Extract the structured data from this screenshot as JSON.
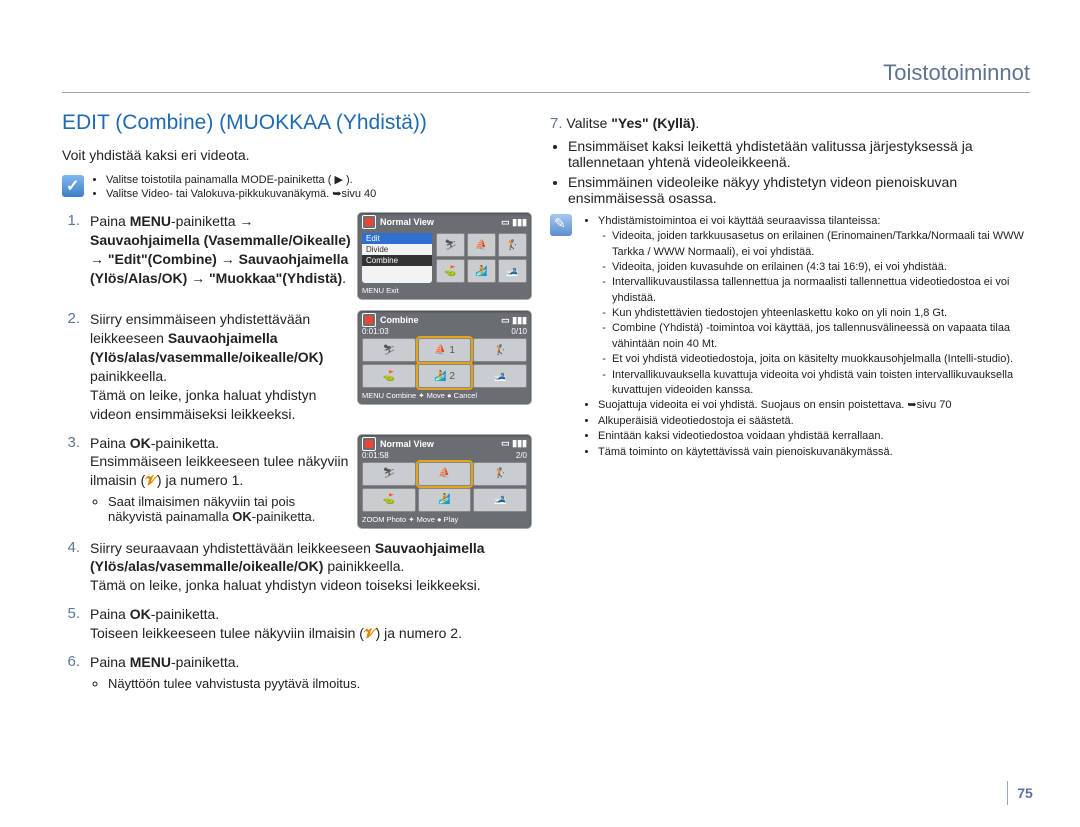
{
  "section": "Toistotoiminnot",
  "heading": "EDIT (Combine) (MUOKKAA (Yhdistä))",
  "intro": "Voit yhdistää kaksi eri videota.",
  "precheck": [
    "Valitse toistotila painamalla MODE-painiketta ( ▶ ).",
    "Valitse Video- tai Valokuva-pikkukuvanäkymä. ➥sivu 40"
  ],
  "screens": {
    "nv_title": "Normal View",
    "combine_title": "Combine",
    "menu_edit": "Edit",
    "menu_divide": "Divide",
    "menu_combine": "Combine",
    "time": "0:01:03",
    "time2": "0:01:58",
    "counter1": "0/10",
    "counter2": "2/0",
    "footer_menu": "MENU Exit",
    "footer_combine": "MENU Combine  ✦ Move  ● Cancel",
    "footer_nv": "ZOOM Photo  ✦ Move  ● Play"
  },
  "steps": [
    {
      "html": "Paina <b>MENU</b>-painiketta → <b>Sauvaohjaimella (Vasemmalle/Oikealle)</b> → <b>\"Edit\"(Combine)</b> → <b>Sauvaohjaimella (Ylös/Alas/OK)</b> → <b>\"Muokkaa\"(Yhdistä)</b>.",
      "screen": "nv1"
    },
    {
      "html": "Siirry ensimmäiseen yhdistettävään leikkeeseen <b>Sauvaohjaimella (Ylös/alas/vasemmalle/oikealle/OK)</b> painikkeella.<br>Tämä on leike, jonka haluat yhdistyn videon ensimmäiseksi leikkeeksi.",
      "screen": "combine"
    },
    {
      "html": "Paina <b>OK</b>-painiketta.<br>Ensimmäiseen leikkeeseen tulee näkyviin ilmaisin (<span class='vmark'>𝓥</span>) ja numero 1.",
      "bullets": [
        "Saat ilmaisimen näkyviin tai pois näkyvistä painamalla <b>OK</b>-painiketta."
      ],
      "screen": "nv2"
    },
    {
      "html": "Siirry seuraavaan yhdistettävään leikkeeseen <b>Sauvaohjaimella (Ylös/alas/vasemmalle/oikealle/OK)</b> painikkeella.<br>Tämä on leike, jonka haluat yhdistyn videon toiseksi leikkeeksi."
    },
    {
      "html": "Paina <b>OK</b>-painiketta.<br>Toiseen leikkeeseen tulee näkyviin ilmaisin (<span class='vmark'>𝓥</span>) ja numero 2."
    },
    {
      "html": "Paina <b>MENU</b>-painiketta.",
      "bullets": [
        "Näyttöön tulee vahvistusta pyytävä ilmoitus."
      ]
    }
  ],
  "step7_label": "7.",
  "step7": "Valitse <b>\"Yes\" (Kyllä)</b>.",
  "step7_bullets": [
    "Ensimmäiset kaksi leikettä yhdistetään valitussa järjestyksessä ja tallennetaan yhtenä videoleikkeenä.",
    "Ensimmäinen videoleike näkyy yhdistetyn videon pienoiskuvan ensimmäisessä osassa."
  ],
  "note": {
    "lead": "Yhdistämistoimintoa ei voi käyttää seuraavissa tilanteissa:",
    "items": [
      "Videoita, joiden tarkkuusasetus on erilainen (Erinomainen/Tarkka/Normaali tai WWW Tarkka / WWW Normaali), ei voi yhdistää.",
      "Videoita, joiden kuvasuhde on erilainen (4:3 tai 16:9), ei voi yhdistää.",
      "Intervallikuvaustilassa tallennettua ja normaalisti tallennettua videotiedostoa ei voi yhdistää.",
      "Kun yhdistettävien tiedostojen yhteenlaskettu koko on yli noin 1,8 Gt.",
      "Combine (Yhdistä) -toimintoa voi käyttää, jos tallennusvälineessä on vapaata tilaa vähintään noin 40 Mt.",
      "Et voi yhdistä videotiedostoja, joita on käsitelty muokkausohjelmalla (Intelli-studio).",
      "Intervallikuvauksella kuvattuja videoita voi yhdistä vain toisten intervallikuvauksella kuvattujen videoiden kanssa."
    ],
    "extra": [
      "Suojattuja videoita ei voi yhdistä. Suojaus on ensin poistettava. ➥sivu 70",
      "Alkuperäisiä videotiedostoja ei säästetä.",
      "Enintään kaksi videotiedostoa voidaan yhdistää kerrallaan.",
      "Tämä toiminto on käytettävissä vain pienoiskuvanäkymässä."
    ]
  },
  "pagenum": "75"
}
